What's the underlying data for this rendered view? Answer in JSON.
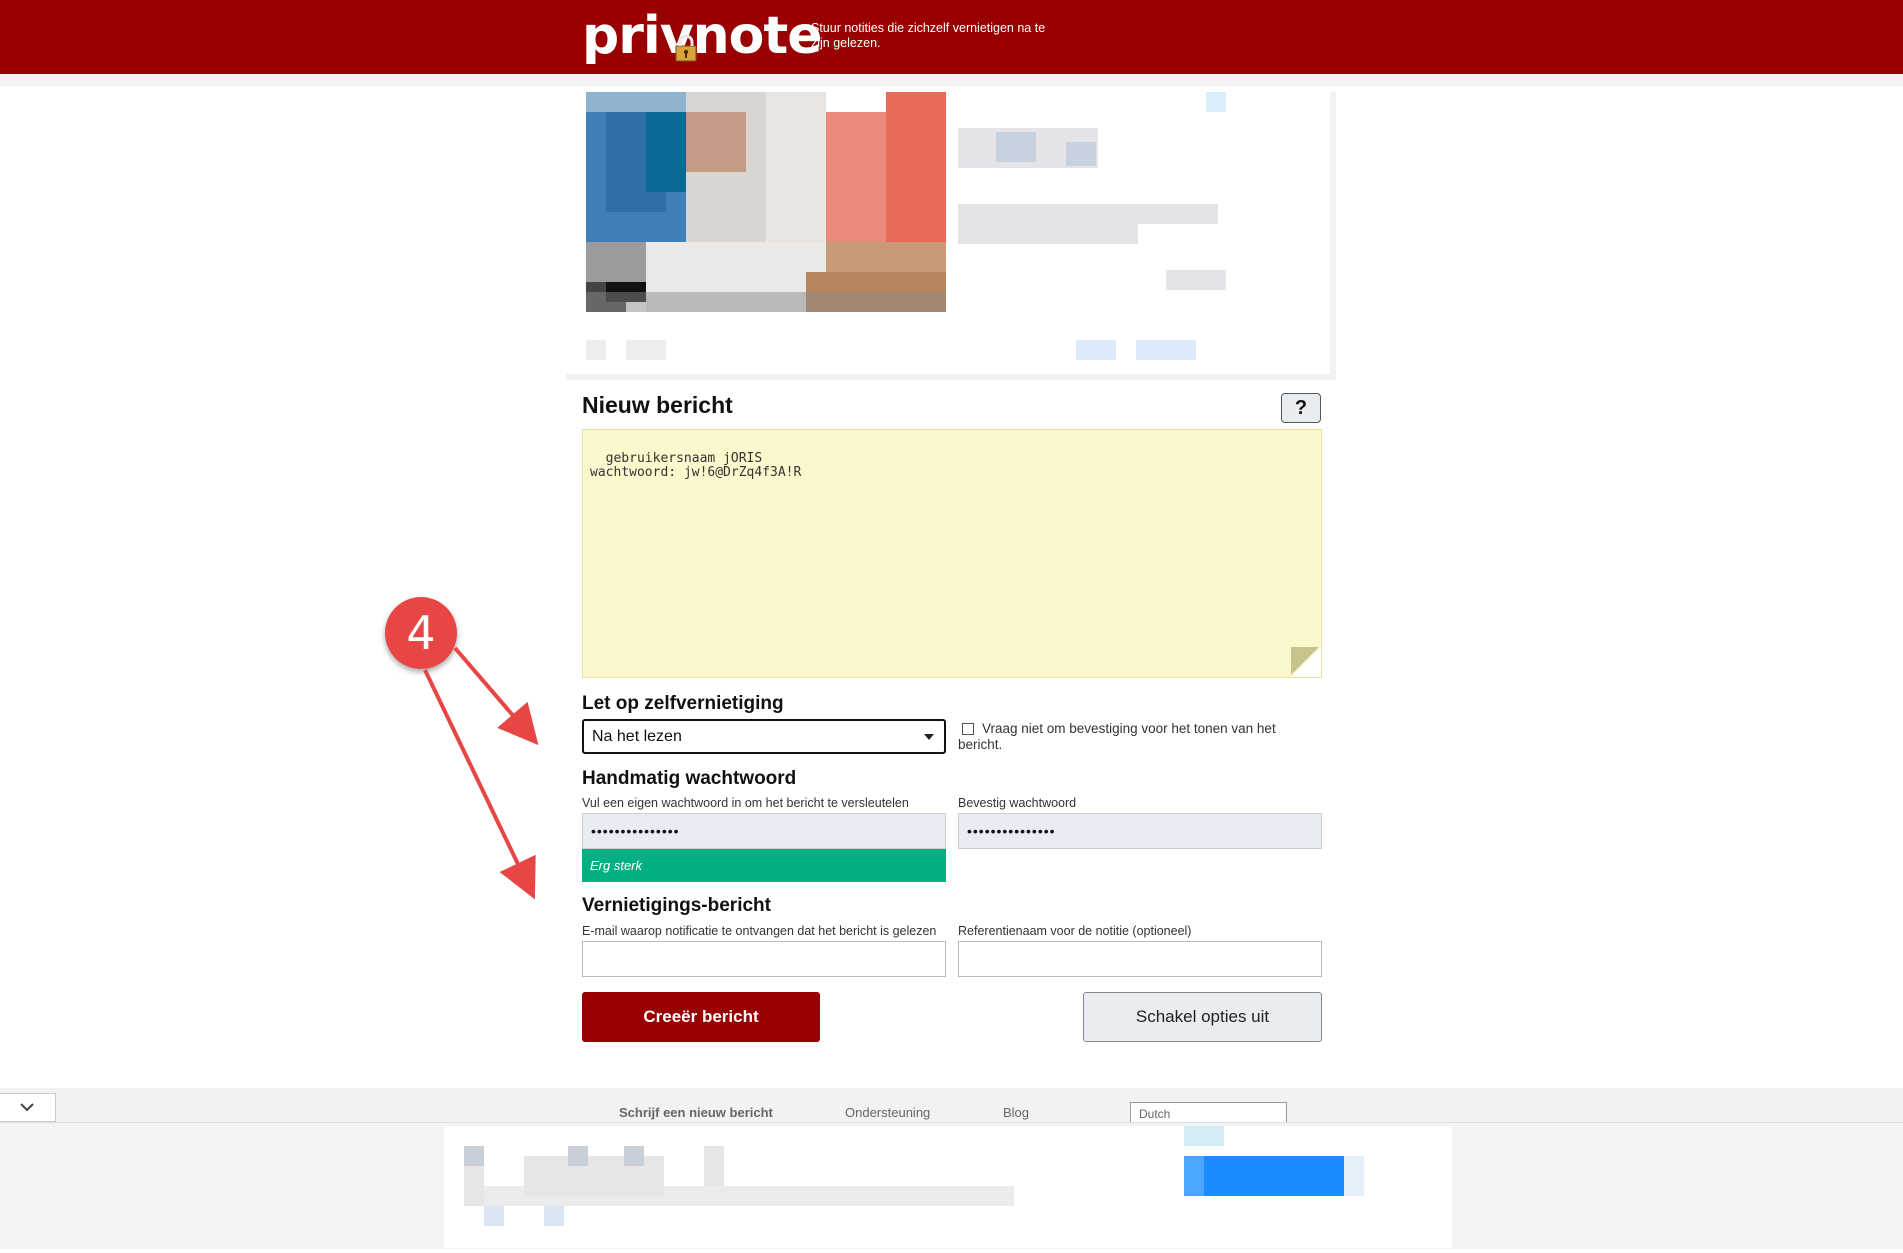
{
  "header": {
    "logo": "privnote",
    "tagline": "Stuur notities die zichzelf vernietigen na te zijn gelezen."
  },
  "form": {
    "title": "Nieuw bericht",
    "help_label": "?",
    "note_text": "gebruikersnaam jORIS\nwachtwoord: jw!6@DrZq4f3A!R",
    "destruction_heading": "Let op zelfvernietiging",
    "destruction_value": "Na het lezen",
    "confirm_checkbox_label": "Vraag niet om bevestiging voor het tonen van het bericht.",
    "password_heading": "Handmatig wachtwoord",
    "password_label": "Vul een eigen wachtwoord in om het bericht te versleutelen",
    "password_value": "•••••••••••••••",
    "confirm_password_label": "Bevestig wachtwoord",
    "confirm_password_value": "•••••••••••••••",
    "strength_label": "Erg sterk",
    "notify_heading": "Vernietigings-bericht",
    "email_label": "E-mail waarop notificatie te ontvangen dat het bericht is gelezen",
    "reference_label": "Referentienaam voor de notitie (optioneel)",
    "create_button": "Creeër bericht",
    "toggle_options_button": "Schakel opties uit"
  },
  "footer": {
    "links": [
      "Schrijf een nieuw bericht",
      "Ondersteuning",
      "Blog"
    ],
    "language": "Dutch"
  },
  "annotation": {
    "step_number": "4",
    "color": "#e84545"
  },
  "colors": {
    "brand": "#990000",
    "note_background": "#fcf8cd",
    "strength_green": "#02b084"
  }
}
